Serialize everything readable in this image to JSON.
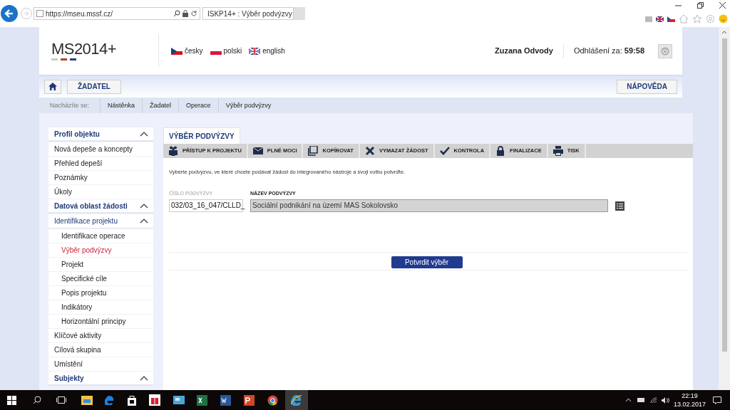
{
  "browser": {
    "url": "https://mseu.mssf.cz/",
    "tab_title": "ISKP14+ : Výběr podvýzvy"
  },
  "header": {
    "logo": "MS2014+",
    "languages": [
      {
        "kind": "cz",
        "label": "česky"
      },
      {
        "kind": "pl",
        "label": "polski"
      },
      {
        "kind": "en",
        "label": "english"
      }
    ],
    "user": "Zuzana Odvody",
    "logout_label": "Odhlášení za:",
    "logout_time": "59:58"
  },
  "nav": {
    "button": "ŽADATEL",
    "help": "NÁPOVĚDA"
  },
  "breadcrumb": {
    "label": "Nacházíte se:",
    "items": [
      "Nástěnka",
      "Žadatel",
      "Operace",
      "Výběr podvýzvy"
    ]
  },
  "sidebar": {
    "items": [
      {
        "label": "Profil objektu",
        "kind": "section",
        "expanded": true,
        "selected": false,
        "children": [
          {
            "label": "Nová depeše a koncepty",
            "kind": "item",
            "selected": false
          },
          {
            "label": "Přehled depeší",
            "kind": "item",
            "selected": false
          },
          {
            "label": "Poznámky",
            "kind": "item",
            "selected": false
          },
          {
            "label": "Úkoly",
            "kind": "item",
            "selected": false
          }
        ]
      },
      {
        "label": "Datová oblast žádosti",
        "kind": "section",
        "expanded": true,
        "selected": false,
        "children": [
          {
            "label": "Identifikace projektu",
            "kind": "subsection",
            "expanded": true,
            "selected": false,
            "children": [
              {
                "label": "Identifikace operace",
                "kind": "item",
                "selected": false
              },
              {
                "label": "Výběr podvýzvy",
                "kind": "item",
                "selected": true
              },
              {
                "label": "Projekt",
                "kind": "item",
                "selected": false
              },
              {
                "label": "Specifické cíle",
                "kind": "item",
                "selected": false
              },
              {
                "label": "Popis projektu",
                "kind": "item",
                "selected": false
              },
              {
                "label": "Indikátory",
                "kind": "item",
                "selected": false
              },
              {
                "label": "Horizontální principy",
                "kind": "item",
                "selected": false
              }
            ]
          },
          {
            "label": "Klíčové aktivity",
            "kind": "item",
            "selected": false
          },
          {
            "label": "Cílová skupina",
            "kind": "item",
            "selected": false
          },
          {
            "label": "Umístění",
            "kind": "item",
            "selected": false
          }
        ]
      },
      {
        "label": "Subjekty",
        "kind": "section",
        "expanded": true,
        "selected": false
      }
    ]
  },
  "main": {
    "tab": "VÝBĚR PODVÝZVY",
    "actions": [
      {
        "kind": "people",
        "label": "PŘÍSTUP K PROJEKTU"
      },
      {
        "kind": "mail",
        "label": "PLNÉ MOCI"
      },
      {
        "kind": "copy",
        "label": "KOPÍROVAT"
      },
      {
        "kind": "delete",
        "label": "VYMAZAT ŽÁDOST"
      },
      {
        "kind": "check",
        "label": "KONTROLA"
      },
      {
        "kind": "lock",
        "label": "FINALIZACE"
      },
      {
        "kind": "print",
        "label": "TISK"
      }
    ],
    "intro": "Vyberte podvýzvu, ve které chcete podávat žádost do integrovaného nástroje a svoji volbu potvrďte.",
    "fields": [
      {
        "label": "ČÍSLO PODVÝZVY",
        "value": "032/03_16_047/CLLD_",
        "disabled": false
      },
      {
        "label": "NÁZEV PODVÝZVY",
        "value": "Sociální podnikání na území MAS Sokolovsko",
        "disabled": true
      }
    ],
    "confirm": "Potvrdit výběr"
  },
  "taskbar": {
    "time": "22:19",
    "date": "13.02.2017"
  }
}
